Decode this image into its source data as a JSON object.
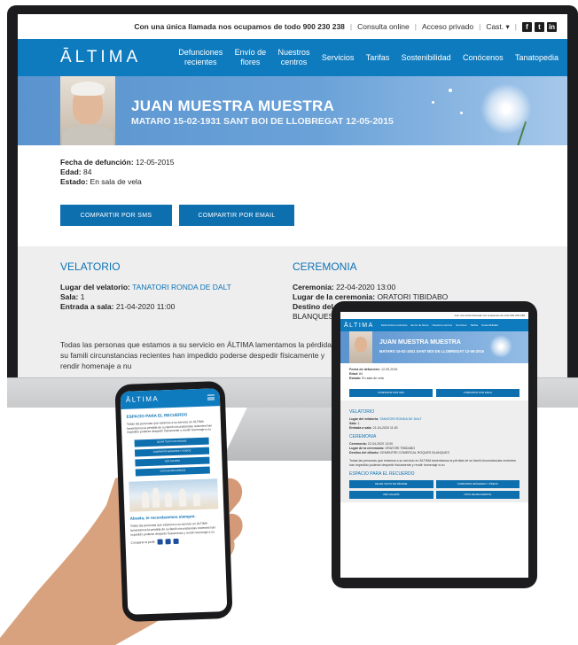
{
  "topbar": {
    "phone_text": "Con una única llamada nos ocupamos de todo 900 230 238",
    "consulta": "Consulta online",
    "acceso": "Acceso privado",
    "lang": "Cast. ▾"
  },
  "nav": {
    "logo": "ĀLTIMA",
    "items": [
      "Defunciones\nrecientes",
      "Envío de\nflores",
      "Nuestros\ncentros",
      "Servicios",
      "Tarifas",
      "Sostenibilidad",
      "Conócenos",
      "Tanatopedia"
    ]
  },
  "hero": {
    "name": "JUAN MUESTRA MUESTRA",
    "dates": "MATARO 15-02-1931 SANT BOI DE LLOBREGAT 12-05-2015"
  },
  "info": {
    "fecha_label": "Fecha de defunción:",
    "fecha_value": "12-05-2015",
    "edad_label": "Edad:",
    "edad_value": "84",
    "estado_label": "Estado:",
    "estado_value": "En sala de vela"
  },
  "share": {
    "sms": "COMPARTIR POR SMS",
    "email": "COMPARTIR POR EMAIL"
  },
  "velatorio": {
    "title": "VELATORIO",
    "lugar_label": "Lugar del velatorio:",
    "lugar_value": "TANATORI RONDA DE DALT",
    "sala_label": "Sala:",
    "sala_value": "1",
    "entrada_label": "Entrada a sala:",
    "entrada_value": "21-04-2020 11:00"
  },
  "ceremonia": {
    "title": "CEREMONIA",
    "ceremonia_label": "Ceremonia:",
    "ceremonia_value": "22-04-2020 13:00",
    "lugar_label": "Lugar de la ceremonia:",
    "lugar_value": "ORATORI TIBIDABO",
    "destino_label": "Destino del difunto:",
    "destino_value": "CEMENTIRI COMERCAL ROQUES BLANQUES"
  },
  "paragraph": "Todas las personas que estamos a su servicio en ÁLTIMA lamentamos la pérdida de su famili circunstancias recientes han impedido poderse despedir físicamente y rendir homenaje a nu",
  "tablet": {
    "recuerdo_title": "ESPACIO PARA EL RECUERDO",
    "btn1": "DEJAR TEXTO DE PÉSAME",
    "btn2": "COMPARTIR IMÁGENES Y VÍDEOS",
    "btn3": "VER GALERÍA",
    "btn4": "VISTA DE RECUERDOS"
  },
  "phone": {
    "logo": "ĀLTIMA",
    "recuerdo_title": "ESPACIO PARA EL RECUERDO",
    "btn1": "DEJAR TEXTO DE PÉSAME",
    "btn2": "COMPARTIR IMÁGENES Y VÍDEOS",
    "btn3": "VER GALERÍA",
    "btn4": "VISTA DE RECUERDOS",
    "abuela_title": "Abuela, te recordaremos siempre.",
    "compartir": "Comparte el perfil"
  },
  "colors": {
    "brand_blue": "#0e7bbf",
    "button_blue": "#0e6fae",
    "heading_blue": "#0e73b5"
  }
}
